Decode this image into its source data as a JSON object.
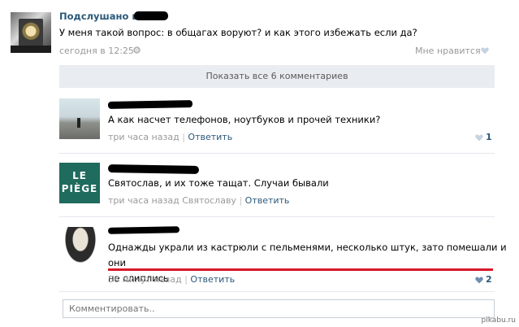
{
  "post": {
    "author": "Подслушано в",
    "text": "У меня такой вопрос: в общагах воруют? и как этого избежать если да?",
    "time": "сегодня в 12:25",
    "like_label": "Мне нравится"
  },
  "show_all": "Показать все 6 комментариев",
  "comments": [
    {
      "text": "А как насчет телефонов, ноутбуков и прочей техники?",
      "time": "три часа назад",
      "reply_to": "",
      "reply_label": "Ответить",
      "likes": "1",
      "avatar": "photo-avatar"
    },
    {
      "text": "Святослав, и их тоже тащат. Случаи бывали",
      "time": "три часа назад",
      "reply_to": "Святославу",
      "reply_label": "Ответить",
      "likes": "",
      "avatar_lines": [
        "LE",
        "PIÈGE"
      ]
    },
    {
      "text_line1": "Однажды украли из кастрюли с пельменями, несколько штук, зато помешали и они",
      "text_line2": "не слиплись",
      "time": "58 минут назад",
      "reply_to": "",
      "reply_label": "Ответить",
      "likes": "2"
    }
  ],
  "comment_input": {
    "placeholder": "Комментировать.."
  },
  "watermark": "pikabu.ru",
  "colors": {
    "link": "#2b587a",
    "meta": "#999999",
    "accent_line": "#d8192b"
  }
}
